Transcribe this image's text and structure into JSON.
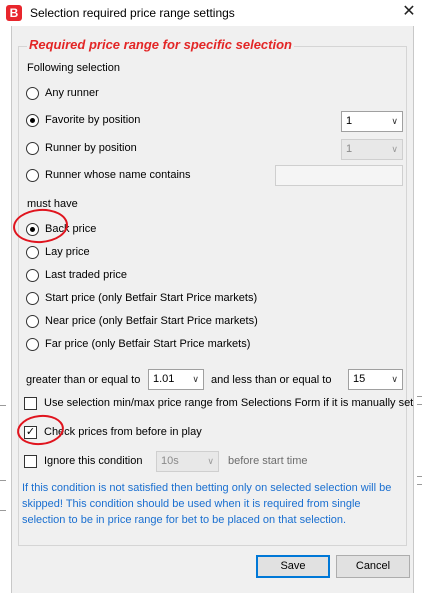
{
  "window": {
    "app_logo": "B",
    "title": "Selection required price range settings",
    "close_glyph": "✕"
  },
  "group": {
    "title": "Required price range for specific selection"
  },
  "selection": {
    "heading": "Following selection",
    "options": [
      {
        "label": "Any runner",
        "selected": false
      },
      {
        "label": "Favorite by position",
        "selected": true
      },
      {
        "label": "Runner by position",
        "selected": false
      },
      {
        "label": "Runner whose name contains",
        "selected": false
      }
    ],
    "favorite_position": "1",
    "runner_position": "1",
    "name_contains": ""
  },
  "must_have": {
    "heading": "must have",
    "options": [
      {
        "label": "Back price",
        "selected": true
      },
      {
        "label": "Lay price",
        "selected": false
      },
      {
        "label": "Last traded price",
        "selected": false
      },
      {
        "label": "Start price (only Betfair Start Price markets)",
        "selected": false
      },
      {
        "label": "Near price (only Betfair Start Price markets)",
        "selected": false
      },
      {
        "label": "Far price (only Betfair Start Price markets)",
        "selected": false
      }
    ]
  },
  "range": {
    "gte_label": "greater than or equal to",
    "gte_value": "1.01",
    "lte_label": "and less than or equal to",
    "lte_value": "15"
  },
  "options": {
    "use_selection_range": {
      "label": "Use selection min/max price range from Selections Form if it is manually set",
      "checked": false
    },
    "check_before_inplay": {
      "label": "Check prices from before in play",
      "checked": true
    },
    "ignore_condition": {
      "label": "Ignore this condition",
      "checked": false,
      "value": "10s",
      "suffix": "before start time"
    }
  },
  "info_text": "If this condition is not satisfied then betting only on selected selection will be skipped! This condition should be used when it is required from single selection to be in price range for bet to be placed on that selection.",
  "buttons": {
    "save": "Save",
    "cancel": "Cancel"
  },
  "icons": {
    "dropdown": "chevron-down-icon",
    "check": "✓",
    "arrow_glyph": "∨"
  },
  "colors": {
    "title_red": "#e32626",
    "info_blue": "#1a6fd0",
    "annotation_red": "#e0141e"
  }
}
